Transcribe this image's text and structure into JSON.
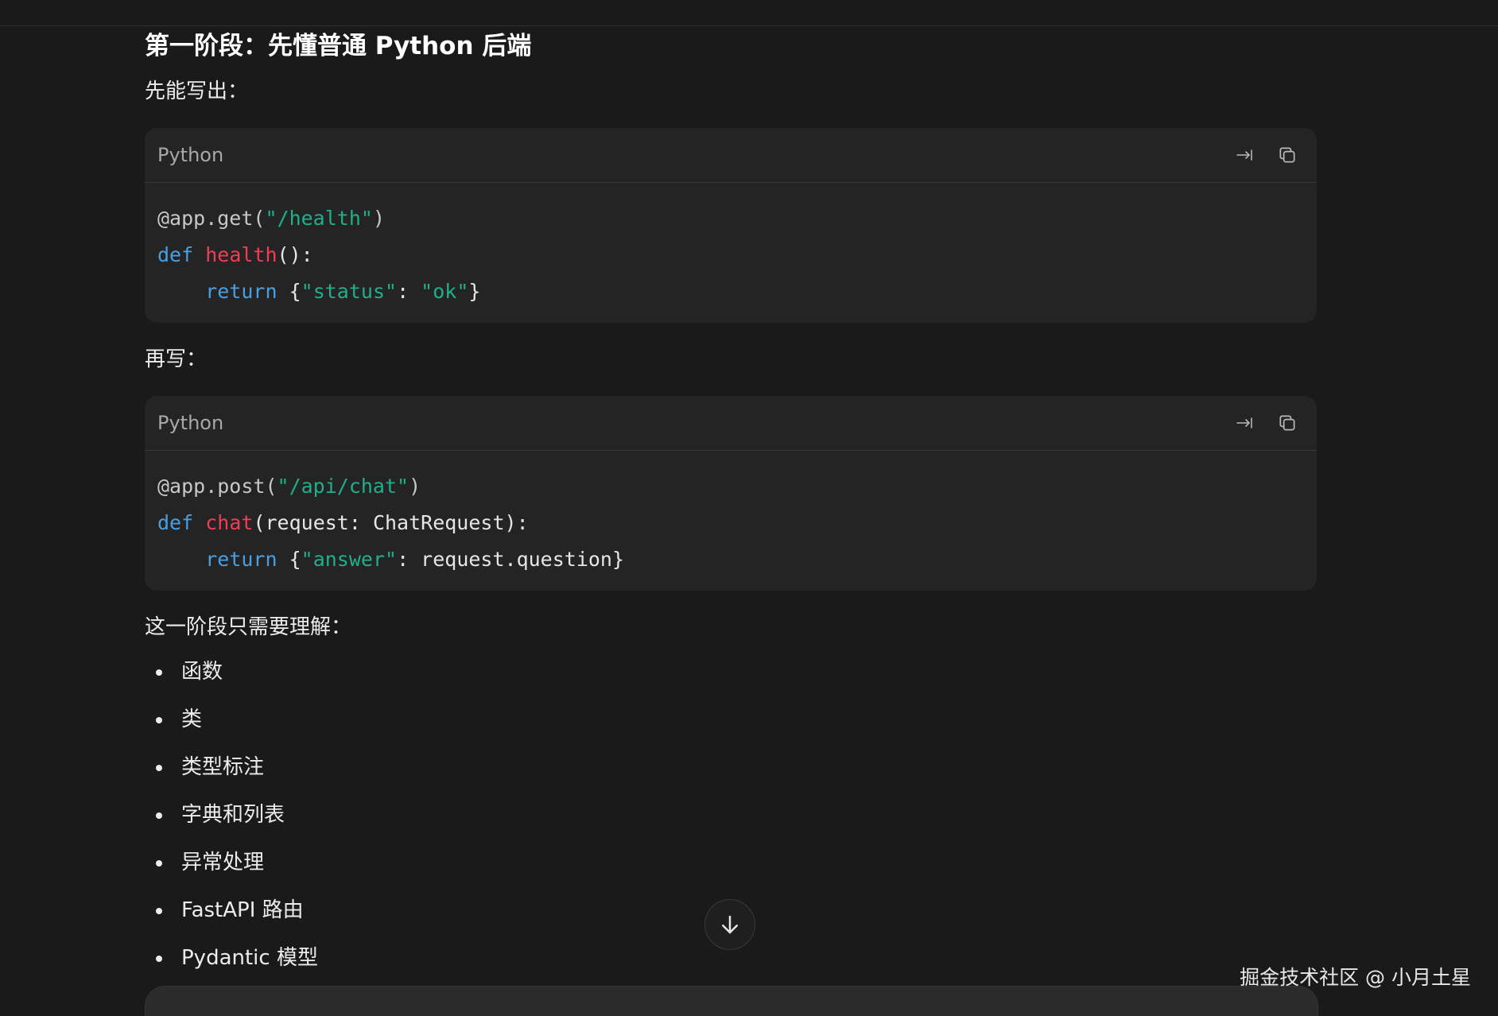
{
  "section": {
    "heading": "第一阶段：先懂普通 Python 后端",
    "intro_text": "先能写出：",
    "second_text": "再写：",
    "understand_text": "这一阶段只需要理解："
  },
  "code_blocks": [
    {
      "language": "Python",
      "lines": [
        [
          {
            "t": "@app.get(",
            "c": "deco"
          },
          {
            "t": "\"/health\"",
            "c": "str"
          },
          {
            "t": ")",
            "c": "deco"
          }
        ],
        [
          {
            "t": "def",
            "c": "kw"
          },
          {
            "t": " ",
            "c": "plain"
          },
          {
            "t": "health",
            "c": "fn"
          },
          {
            "t": "():",
            "c": "plain"
          }
        ],
        [
          {
            "t": "    ",
            "c": "plain"
          },
          {
            "t": "return",
            "c": "kw"
          },
          {
            "t": " {",
            "c": "plain"
          },
          {
            "t": "\"status\"",
            "c": "str"
          },
          {
            "t": ": ",
            "c": "plain"
          },
          {
            "t": "\"ok\"",
            "c": "str"
          },
          {
            "t": "}",
            "c": "plain"
          }
        ]
      ]
    },
    {
      "language": "Python",
      "lines": [
        [
          {
            "t": "@app.post(",
            "c": "deco"
          },
          {
            "t": "\"/api/chat\"",
            "c": "str"
          },
          {
            "t": ")",
            "c": "deco"
          }
        ],
        [
          {
            "t": "def",
            "c": "kw"
          },
          {
            "t": " ",
            "c": "plain"
          },
          {
            "t": "chat",
            "c": "fn"
          },
          {
            "t": "(request: ChatRequest):",
            "c": "plain"
          }
        ],
        [
          {
            "t": "    ",
            "c": "plain"
          },
          {
            "t": "return",
            "c": "kw"
          },
          {
            "t": " {",
            "c": "plain"
          },
          {
            "t": "\"answer\"",
            "c": "str"
          },
          {
            "t": ": request.question}",
            "c": "plain"
          }
        ]
      ]
    }
  ],
  "bullet_items": [
    "函数",
    "类",
    "类型标注",
    "字典和列表",
    "异常处理",
    "FastAPI 路由",
    "Pydantic 模型"
  ],
  "icons": {
    "wrap": "wrap-lines-icon",
    "copy": "copy-icon",
    "scroll": "arrow-down-icon"
  },
  "colors": {
    "background": "#1a1a1a",
    "code_bg": "#242424",
    "keyword": "#4a9fe0",
    "string": "#1fb08a",
    "function": "#ef3e55"
  },
  "watermark": "掘金技术社区 @ 小月土星"
}
